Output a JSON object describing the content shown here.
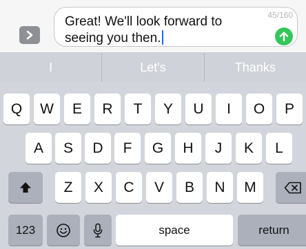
{
  "compose": {
    "message": "Great! We'll look forward to seeing you then.",
    "counter": "45/160",
    "expand_icon": "chevron-right-icon",
    "send_icon": "arrow-up-icon",
    "send_color": "#34c759"
  },
  "suggestions": [
    "I",
    "Let's",
    "Thanks"
  ],
  "keyboard": {
    "row1": [
      "Q",
      "W",
      "E",
      "R",
      "T",
      "Y",
      "U",
      "I",
      "O",
      "P"
    ],
    "row2": [
      "A",
      "S",
      "D",
      "F",
      "G",
      "H",
      "J",
      "K",
      "L"
    ],
    "row3": [
      "Z",
      "X",
      "C",
      "V",
      "B",
      "N",
      "M"
    ],
    "shift_icon": "shift-arrow-icon",
    "delete_icon": "backspace-icon",
    "numbers_label": "123",
    "emoji_icon": "emoji-icon",
    "mic_icon": "microphone-icon",
    "space_label": "space",
    "return_label": "return"
  }
}
